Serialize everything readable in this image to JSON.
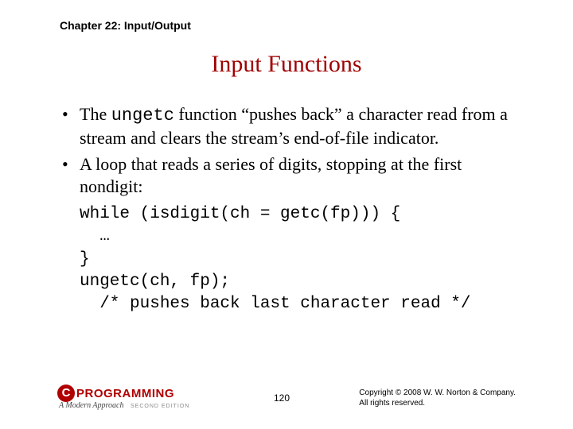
{
  "chapter": "Chapter 22: Input/Output",
  "title": "Input Functions",
  "bullet1_pre": "The ",
  "bullet1_code": "ungetc",
  "bullet1_post": " function “pushes back” a character read from a stream and clears the stream’s end-of-file indicator.",
  "bullet2": "A loop that reads a series of digits, stopping at the first nondigit:",
  "code": "while (isdigit(ch = getc(fp))) {\n  …\n}\nungetc(ch, fp);\n  /* pushes back last character read */",
  "logo": {
    "c": "C",
    "word": "PROGRAMMING",
    "sub": "A Modern Approach",
    "edition": "SECOND EDITION"
  },
  "page_number": "120",
  "copyright_line1": "Copyright © 2008 W. W. Norton & Company.",
  "copyright_line2": "All rights reserved."
}
